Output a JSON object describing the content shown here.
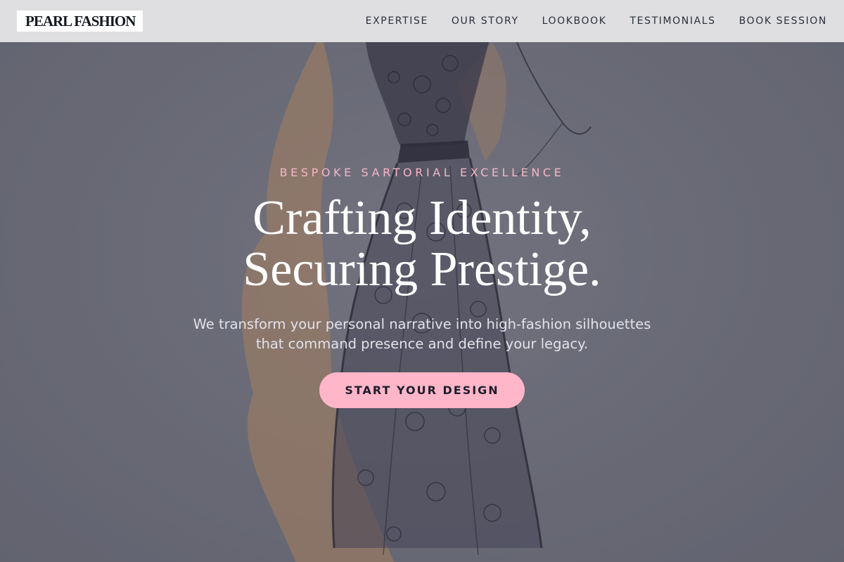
{
  "brand": {
    "name": "PEARL FASHION"
  },
  "nav": {
    "items": [
      {
        "label": "EXPERTISE"
      },
      {
        "label": "OUR STORY"
      },
      {
        "label": "LOOKBOOK"
      },
      {
        "label": "TESTIMONIALS"
      },
      {
        "label": "BOOK SESSION"
      }
    ]
  },
  "hero": {
    "eyebrow": "BESPOKE SARTORIAL EXCELLENCE",
    "title_line1": "Crafting Identity,",
    "title_line2": "Securing Prestige.",
    "subtitle_line1": "We transform your personal narrative into high-fashion silhouettes",
    "subtitle_line2": "that command presence and define your legacy.",
    "cta_label": "START YOUR DESIGN",
    "background_image": "dress-sketch-illustration"
  },
  "colors": {
    "accent_pink": "#ffb6c8",
    "eyebrow_pink": "#f6b6c6",
    "header_bg": "#e8e8eb",
    "text_dark": "#1d1d2b",
    "hero_overlay": "#6b6c78"
  }
}
